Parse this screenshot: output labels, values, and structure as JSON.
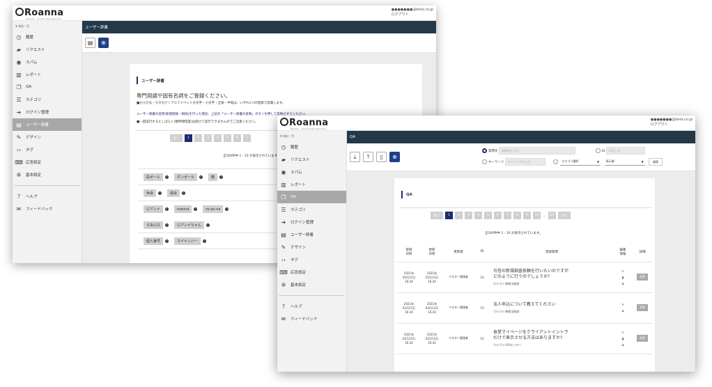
{
  "sidebar": {
    "header": "▼ 機能一覧",
    "items": [
      {
        "label": "履歴",
        "icon": "clock-icon"
      },
      {
        "label": "リクエスト",
        "icon": "chat-bubble-icon"
      },
      {
        "label": "スパム",
        "icon": "eye-icon"
      },
      {
        "label": "レポート",
        "icon": "bar-chart-icon"
      },
      {
        "label": "QA",
        "icon": "qa-icon"
      },
      {
        "label": "カテゴリ",
        "icon": "list-icon"
      },
      {
        "label": "ログイン管理",
        "icon": "login-icon"
      },
      {
        "label": "ユーザー辞書",
        "icon": "book-icon"
      },
      {
        "label": "デザイン",
        "icon": "brush-icon"
      },
      {
        "label": "タグ",
        "icon": "code-icon"
      },
      {
        "label": "応答設定",
        "icon": "response-icon"
      },
      {
        "label": "基本設定",
        "icon": "gear-icon"
      }
    ],
    "footer_items": [
      {
        "label": "ヘルプ",
        "icon": "help-icon"
      },
      {
        "label": "フィードバック",
        "icon": "mail-icon"
      }
    ]
  },
  "logo": {
    "name": "Roanna",
    "tagline": "Roanna - Answer Management"
  },
  "user": {
    "email": "●●●●●●●@beta.co.jp",
    "logout": "ログアウト"
  },
  "win1": {
    "header": "ユーザー辞書",
    "section_title": "ユーザー辞書",
    "lead": "専門用語や固有名詞をご登録ください。",
    "note1": "■ひらがな・カタカナ / アルファベット大文字・小文字・全角・半角は、いずれ1つの登録で認識します。",
    "note2": "ユーザー辞書の変更(新規登録・削除)を行った場合、上記の「ユーザー辞書の反映」ボタンを押して反映させてください。",
    "note3": "■一度実行するとしばらく(数時間程度)は続けて実行できませんのでご注意ください。",
    "pager": {
      "prev": "前へ",
      "pages": [
        "1",
        "2",
        "3",
        "4",
        "5",
        "6",
        "7"
      ],
      "current": "1"
    },
    "count": "全160件中 1 - 10 が表示されています。",
    "rows": [
      [
        "段ボール",
        "ダンボール",
        "箱"
      ],
      [
        "休会",
        "退会"
      ],
      [
        "ロアンナ",
        "roanna",
        "ro-an-na"
      ],
      [
        "ろあんな",
        "ロアンナちゃん"
      ],
      [
        "個人番号",
        "マイナンバー"
      ]
    ]
  },
  "win2": {
    "header": "QA",
    "search": {
      "radio_question": "質問文",
      "question_placeholder": "質問文を入力",
      "radio_id": "ID",
      "id_placeholder": "IDを入力",
      "radio_keyword": "キーワード",
      "keyword_placeholder": "キーワードを入力",
      "category_select": "カテゴリ選択",
      "order_select": "表示順",
      "search_button": "検索"
    },
    "section_title": "QA",
    "pager": {
      "prev": "前へ",
      "pages": [
        "1",
        "2",
        "3",
        "4",
        "5",
        "6",
        "7",
        "8",
        "9",
        "10"
      ],
      "ellipsis": "...",
      "last": "16",
      "next": "次へ",
      "current": "1"
    },
    "count": "全160件中 1 - 10 が表示されています。",
    "columns": {
      "created": "登録\n日時",
      "updated": "更新\n日時",
      "updater": "更新者",
      "id": "ID",
      "question": "登録質問",
      "edit": "編集\n情報",
      "detail": "詳細"
    },
    "rows": [
      {
        "created": "2021年\n02月13日\n16:34",
        "updated": "2021年\n02月13日\n16:34",
        "updater": "マスター管理者",
        "id": "14",
        "question": "与信の新規調査依頼を行いたいのですが\nどのように行うのでしょうか?",
        "category": "カテゴリ:総務法務部",
        "action": "変更"
      },
      {
        "created": "2021年\n02月13日\n16:34",
        "updated": "2021年\n02月13日\n16:34",
        "updater": "マスター管理者",
        "id": "13",
        "question": "法人申込について教えてください",
        "category": "カテゴリ:総務法務部",
        "action": "変更"
      },
      {
        "created": "2021年\n02月12日\n16:34",
        "updated": "2021年\n02月13日\n16:34",
        "updater": "マスター管理者",
        "id": "12",
        "question": "食堂マイページをクライアントイントラ\nだけで表示させる方法はありますか?",
        "category": "カテゴリ:IOSセンター",
        "action": "変更"
      }
    ]
  }
}
